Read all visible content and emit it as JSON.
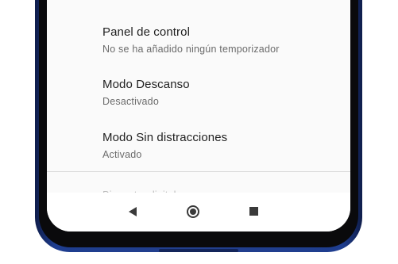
{
  "settings": {
    "items": [
      {
        "title": "Panel de control",
        "summary": "No se ha añadido ningún temporizador"
      },
      {
        "title": "Modo Descanso",
        "summary": "Desactivado"
      },
      {
        "title": "Modo Sin distracciones",
        "summary": "Activado"
      }
    ],
    "partially_hidden_item": "Bienestar digital"
  },
  "navigation_bar": {
    "back": "back-icon",
    "home": "home-icon",
    "recents": "recents-icon"
  },
  "colors": {
    "phone_frame": "#223f8c",
    "screen_background": "#fafafa",
    "title_text": "#212121",
    "summary_text": "#6b6b6b",
    "nav_icons": "#3a3a3a"
  }
}
